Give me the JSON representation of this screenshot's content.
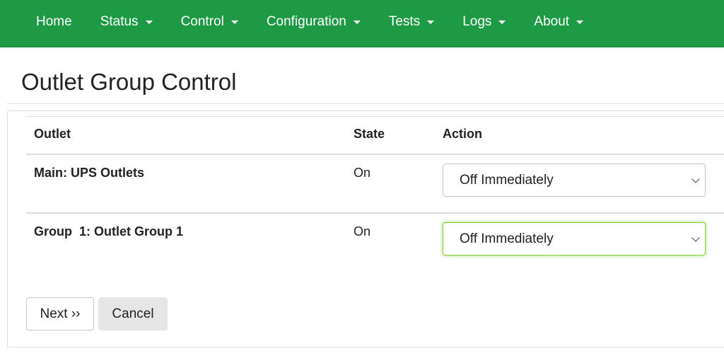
{
  "nav": {
    "items": [
      {
        "label": "Home",
        "has_dropdown": false
      },
      {
        "label": "Status",
        "has_dropdown": true
      },
      {
        "label": "Control",
        "has_dropdown": true
      },
      {
        "label": "Configuration",
        "has_dropdown": true
      },
      {
        "label": "Tests",
        "has_dropdown": true
      },
      {
        "label": "Logs",
        "has_dropdown": true
      },
      {
        "label": "About",
        "has_dropdown": true
      }
    ],
    "caret_icon": "chevron-down-icon",
    "background_color": "#1e9944"
  },
  "page": {
    "title": "Outlet Group Control"
  },
  "table": {
    "headers": {
      "outlet": "Outlet",
      "state": "State",
      "action": "Action"
    },
    "rows": [
      {
        "outlet": "Main: UPS Outlets",
        "state": "On",
        "action": "Off Immediately"
      },
      {
        "outlet": "Group  1: Outlet Group 1",
        "state": "On",
        "action": "Off Immediately"
      }
    ]
  },
  "buttons": {
    "next": "Next ››",
    "cancel": "Cancel"
  },
  "colors": {
    "focus_border": "#8bd13a"
  }
}
